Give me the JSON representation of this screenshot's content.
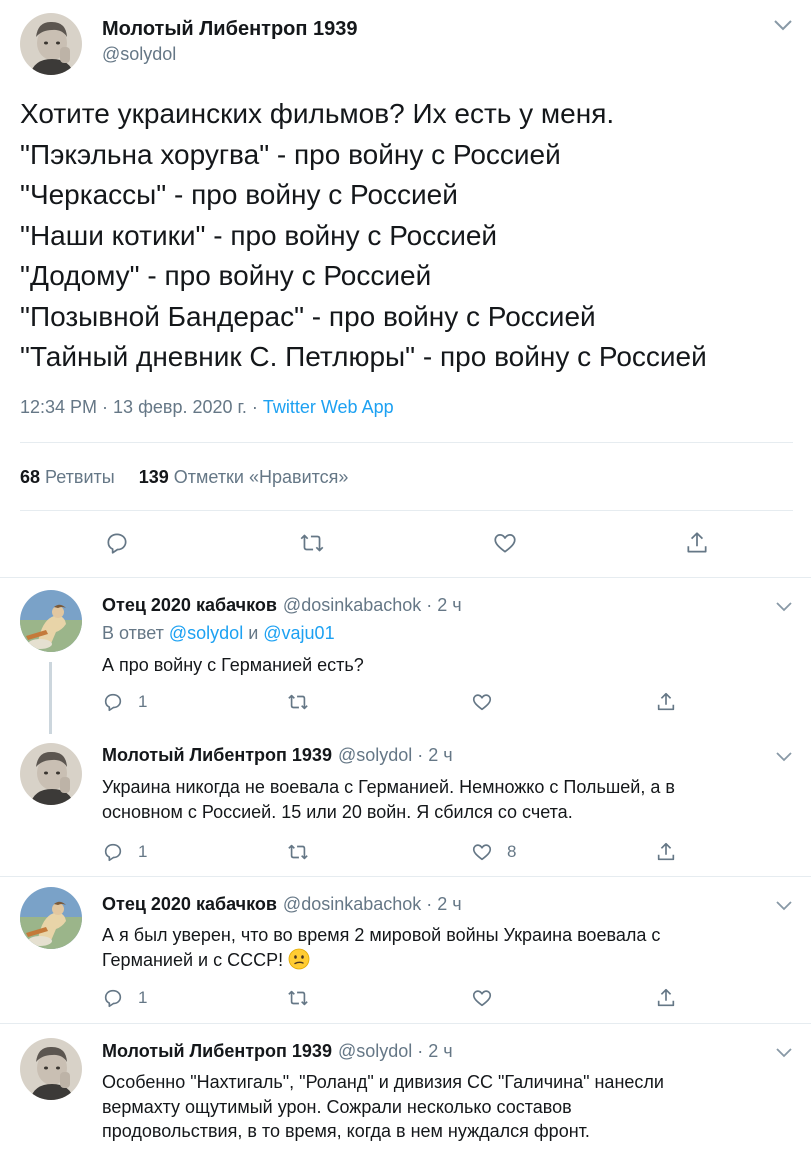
{
  "main_tweet": {
    "author_name": "Молотый Либентроп 1939",
    "author_handle": "@solydol",
    "lines": [
      "Хотите украинских фильмов? Их есть у меня.",
      "\"Пэкэльна хоругва\" - про войну с Россией",
      "\"Черкассы\" - про войну с Россией",
      "\"Наши котики\" - про войну с Россией",
      "\"Додому\" - про войну с Россией",
      "\"Позывной Бандерас\" - про войну с Россией",
      "\"Тайный дневник С. Петлюры\" - про войну с Россией"
    ],
    "time": "12:34 PM · 13 февр. 2020 г. · ",
    "client": "Twitter Web App",
    "retweets_count": "68",
    "retweets_label": "Ретвиты",
    "likes_count": "139",
    "likes_label": "Отметки «Нравится»"
  },
  "replies": [
    {
      "author_name": "Отец 2020 кабачков",
      "author_handle": "@dosinkabachok · 2 ч",
      "reply_to_prefix": "В ответ ",
      "reply_to_user1": "@solydol",
      "reply_to_and": " и ",
      "reply_to_user2": "@vaju01",
      "text": "А про войну с Германией есть?",
      "reply_count": "1",
      "like_count": ""
    },
    {
      "author_name": "Молотый Либентроп 1939",
      "author_handle": "@solydol · 2 ч",
      "text_line1": "Украина никогда не воевала с Германией. Немножко с Польшей, а в",
      "text_line2": "основном с Россией. 15 или 20 войн. Я сбился со счета.",
      "reply_count": "1",
      "like_count": "8"
    },
    {
      "author_name": "Отец 2020 кабачков",
      "author_handle": "@dosinkabachok · 2 ч",
      "text_line1": "А я был уверен, что во время 2 мировой войны Украина воевала с",
      "text_line2": "Германией и с СССР!",
      "emoji": "confused-face",
      "reply_count": "1",
      "like_count": ""
    },
    {
      "author_name": "Молотый Либентроп 1939",
      "author_handle": "@solydol · 2 ч",
      "text_line1": "Особенно \"Нахтигаль\", \"Роланд\" и дивизия СС \"Галичина\" нанесли",
      "text_line2": "вермахту ощутимый урон. Сожрали несколько составов",
      "text_line3": "продовольствия, в то время, когда в нем нуждался фронт."
    }
  ],
  "colors": {
    "text": "#14171a",
    "secondary": "#657786",
    "accent": "#1da1f2",
    "divider": "#e6ecf0",
    "thread_line": "#ccd6dd"
  },
  "icons": [
    "reply-icon",
    "retweet-icon",
    "like-icon",
    "share-icon",
    "chevron-down-icon",
    "confused-face-emoji"
  ]
}
